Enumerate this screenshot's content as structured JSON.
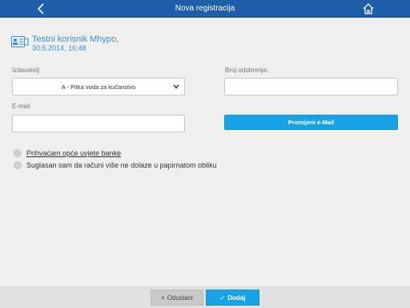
{
  "header": {
    "title": "Nova registracija",
    "back_icon": "chevron-left-icon",
    "home_icon": "home-icon"
  },
  "user": {
    "name": "Testni korisnik Mhypo,",
    "date": "30.5.2014, 16:48",
    "icon": "user-card-icon"
  },
  "form": {
    "issuer_label": "Izdavatelj:",
    "issuer_value": "A - Pitka voda za kučanstvo",
    "approval_label": "Broj odobrenja:",
    "approval_value": "",
    "email_label": "E-mail",
    "email_value": "",
    "change_email_label": "Promijeni e-Mail"
  },
  "consents": [
    {
      "label": "Prihvaćam opće uvjete banke",
      "checked": false
    },
    {
      "label": "Suglasan sam da računi više ne dolaze u papirnatom obliku",
      "checked": false
    }
  ],
  "footer": {
    "cancel_label": "Odustani",
    "cancel_icon": "×",
    "add_label": "Dodaj",
    "add_icon": "✓"
  },
  "colors": {
    "header_bg": "#1e5ea8",
    "accent": "#19a1e6",
    "link_text": "#3a8fd8"
  }
}
